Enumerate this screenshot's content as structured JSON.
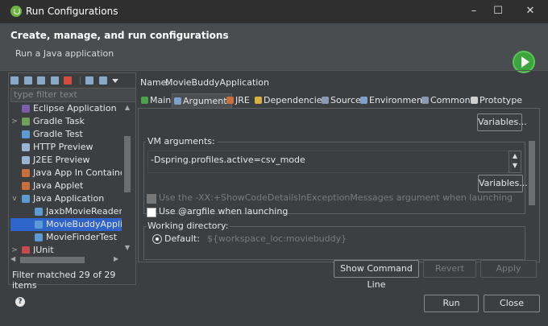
{
  "window": {
    "title": "Run Configurations",
    "controls": [
      "–",
      "☐",
      "✕"
    ]
  },
  "header": {
    "title": "Create, manage, and run configurations",
    "subtitle": "Run a Java application"
  },
  "left": {
    "filter_placeholder": "type filter text",
    "tree": [
      {
        "label": "Eclipse Application",
        "depth": 1,
        "twist": "",
        "icon_color": "#7a5fa8"
      },
      {
        "label": "Gradle Task",
        "depth": 1,
        "twist": ">",
        "icon_color": "#6fa05a"
      },
      {
        "label": "Gradle Test",
        "depth": 1,
        "twist": "",
        "icon_color": "#5a9bd5"
      },
      {
        "label": "HTTP Preview",
        "depth": 1,
        "twist": "",
        "icon_color": "#9ab3cf"
      },
      {
        "label": "J2EE Preview",
        "depth": 1,
        "twist": "",
        "icon_color": "#9ab3cf"
      },
      {
        "label": "Java App In Container",
        "depth": 1,
        "twist": "",
        "icon_color": "#c96e3c"
      },
      {
        "label": "Java Applet",
        "depth": 1,
        "twist": "",
        "icon_color": "#c96e3c"
      },
      {
        "label": "Java Application",
        "depth": 1,
        "twist": "v",
        "icon_color": "#5a9bd5"
      },
      {
        "label": "JaxbMovieReaderTe",
        "depth": 2,
        "twist": "",
        "icon_color": "#5a9bd5"
      },
      {
        "label": "MovieBuddyApplica",
        "depth": 2,
        "twist": "",
        "icon_color": "#5a9bd5",
        "selected": true
      },
      {
        "label": "MovieFinderTest",
        "depth": 2,
        "twist": "",
        "icon_color": "#5a9bd5"
      },
      {
        "label": "JUnit",
        "depth": 1,
        "twist": ">",
        "icon_color": "#c84a4a"
      }
    ],
    "status": "Filter matched 29 of 29 items"
  },
  "right": {
    "name_label": "Name:",
    "name_value": "MovieBuddyApplication",
    "tabs": [
      {
        "label": "Main",
        "icon_color": "#4aa34a"
      },
      {
        "label": "Arguments",
        "icon_color": "#7da0c8",
        "active": true
      },
      {
        "label": "JRE",
        "icon_color": "#c96e3c"
      },
      {
        "label": "Dependencies",
        "icon_color": "#d8b040"
      },
      {
        "label": "Source",
        "icon_color": "#8a9ab0"
      },
      {
        "label": "Environment",
        "icon_color": "#7da0c8"
      },
      {
        "label": "Common",
        "icon_color": "#8a9ab0"
      },
      {
        "label": "Prototype",
        "icon_color": "#d0d0d0"
      }
    ],
    "variables_label": "Variables...",
    "vm_args_label": "VM arguments:",
    "vm_args_value": "-Dspring.profiles.active=csv_mode",
    "show_code_details_label": "Use the -XX:+ShowCodeDetailsInExceptionMessages argument when launching",
    "argfile_label": "Use @argfile when launching",
    "workdir_label": "Working directory:",
    "default_label": "Default:",
    "default_value": "${workspace_loc:moviebuddy}",
    "show_cmd_label": "Show Command Line",
    "revert_label": "Revert",
    "apply_label": "Apply"
  },
  "footer": {
    "run_label": "Run",
    "close_label": "Close"
  }
}
